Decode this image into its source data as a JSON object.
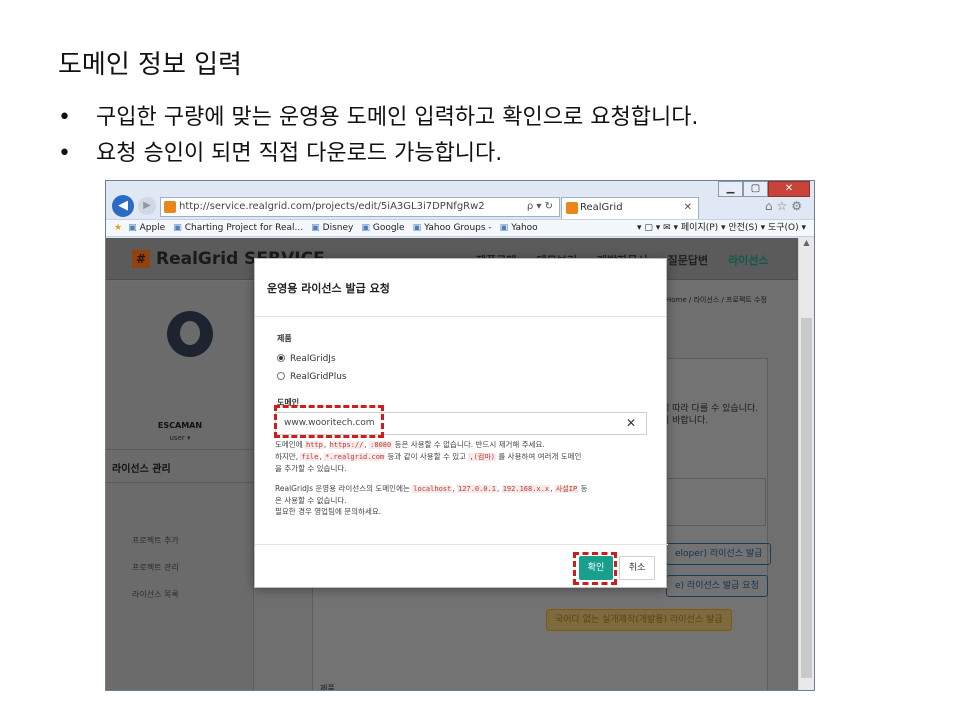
{
  "slide": {
    "title": "도메인 정보 입력",
    "bullets": [
      "구입한 구량에 맞는 운영용 도메인 입력하고 확인으로 요청합니다.",
      "요청 승인이 되면 직접 다운로드 가능합니다."
    ]
  },
  "browser": {
    "url": "http://service.realgrid.com/projects/edit/5iA3GL3i7DPNfgRw2",
    "address_tools": "ρ ▾ ↻",
    "tab_title": "RealGrid",
    "favorites": [
      "Apple",
      "Charting Project for Real...",
      "Disney",
      "Google",
      "Yahoo Groups -",
      "Yahoo"
    ],
    "toolbar_right": "▾ ▢ ▾ ✉ ▾ 페이지(P) ▾  안전(S) ▾  도구(O) ▾"
  },
  "app": {
    "logo": "RealGrid SERVICE",
    "nav": [
      "제품구매",
      "데모보기",
      "개발자문서",
      "질문답변",
      "라이선스"
    ],
    "user_name": "ESCAMAN",
    "user_role": "user ▾",
    "sidebar_section": "라이선스 관리",
    "sidebar_items": [
      "프로젝트 추가",
      "프로젝트 관리",
      "라이선스 목록"
    ],
    "breadcrumb": "Home  /  라이선스  /  프로젝트 수정",
    "content_text_1": "에 따라 다를 수 있습니다.",
    "content_text_2": "기 바랍니다.",
    "btn_dev": "eloper) 라이선스 발급",
    "btn_prod": "e) 라이선스 발급 요청",
    "btn_warn": "국어다 없는 실개제작(개발용) 라이선스 발급",
    "bottom_text": "제품"
  },
  "modal": {
    "title": "운영용 라이선스 발급 요청",
    "product_label": "제품",
    "products": [
      "RealGridJs",
      "RealGridPlus"
    ],
    "selected_product": "RealGridJs",
    "domain_label": "도메인",
    "domain_value": "www.wooritech.com",
    "help_1a": "도메인에",
    "help_1b": "등은 사용할 수 없습니다. 반드시 제거해 주세요.",
    "help_2a": "하지만,",
    "help_2b": "등과 같이 사용할 수 있고",
    "help_2c": "를 사용하여 여러개 도메인",
    "help_2d": "을 추가할 수 있습니다.",
    "help_3a": "RealGridJs 운영용 라이선스의 도메인에는",
    "help_3b": "등",
    "help_3c": "은 사용할 수 없습니다.",
    "help_3d": "필요한 경우 영업팀에 문의하세요.",
    "codes": {
      "http": "http",
      "https": "https://",
      "port": ":8080",
      "file": "file",
      "wild": "*.realgrid.com",
      "comma": ",(컴마)",
      "localhost": "localhost",
      "loop": "127.0.0.1",
      "lan": "192.168.x.x",
      "private": "사설IP"
    },
    "ok_label": "확인",
    "cancel_label": "취소"
  },
  "colors": {
    "highlight": "#d11c1c",
    "primary": "#19a08c"
  }
}
